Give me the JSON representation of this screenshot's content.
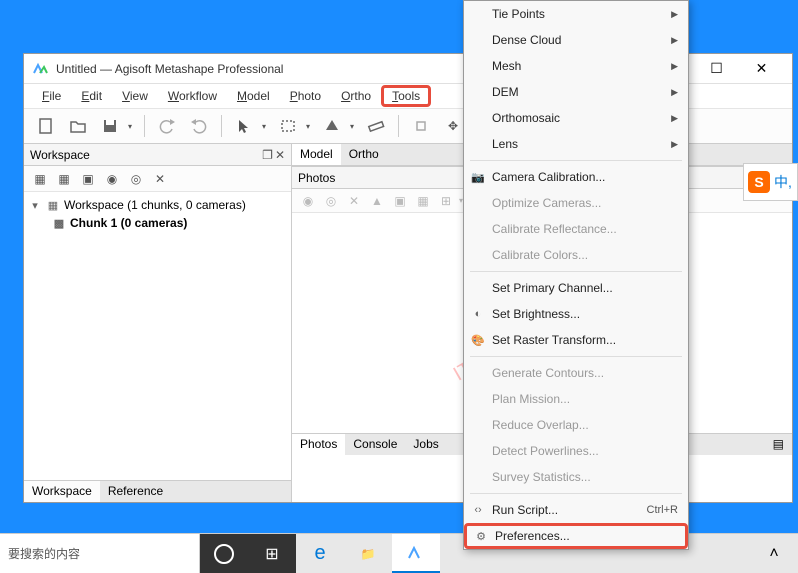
{
  "window": {
    "title": "Untitled — Agisoft Metashape Professional"
  },
  "menubar": {
    "file": "File",
    "edit": "Edit",
    "view": "View",
    "workflow": "Workflow",
    "model": "Model",
    "photo": "Photo",
    "ortho": "Ortho",
    "tools": "Tools"
  },
  "workspace": {
    "panel_title": "Workspace",
    "root": "Workspace (1 chunks, 0 cameras)",
    "chunk": "Chunk 1 (0 cameras)",
    "tabs": {
      "workspace": "Workspace",
      "reference": "Reference"
    }
  },
  "right": {
    "tabs": {
      "model": "Model",
      "ortho": "Ortho"
    },
    "photos_title": "Photos",
    "bottom_tabs": {
      "photos": "Photos",
      "console": "Console",
      "jobs": "Jobs"
    }
  },
  "tools_menu": {
    "tie_points": "Tie Points",
    "dense_cloud": "Dense Cloud",
    "mesh": "Mesh",
    "dem": "DEM",
    "orthomosaic": "Orthomosaic",
    "lens": "Lens",
    "camera_calibration": "Camera Calibration...",
    "optimize_cameras": "Optimize Cameras...",
    "calibrate_reflectance": "Calibrate Reflectance...",
    "calibrate_colors": "Calibrate Colors...",
    "set_primary_channel": "Set Primary Channel...",
    "set_brightness": "Set Brightness...",
    "set_raster_transform": "Set Raster Transform...",
    "generate_contours": "Generate Contours...",
    "plan_mission": "Plan Mission...",
    "reduce_overlap": "Reduce Overlap...",
    "detect_powerlines": "Detect Powerlines...",
    "survey_statistics": "Survey Statistics...",
    "run_script": "Run Script...",
    "run_script_shortcut": "Ctrl+R",
    "preferences": "Preferences..."
  },
  "taskbar": {
    "search_placeholder": "要搜索的内容"
  },
  "sogou": {
    "label": "中,"
  },
  "watermark": "IT技术之家www.ittel.cn",
  "colors": {
    "highlight": "#e74c3c",
    "desktop": "#1a8cff"
  }
}
